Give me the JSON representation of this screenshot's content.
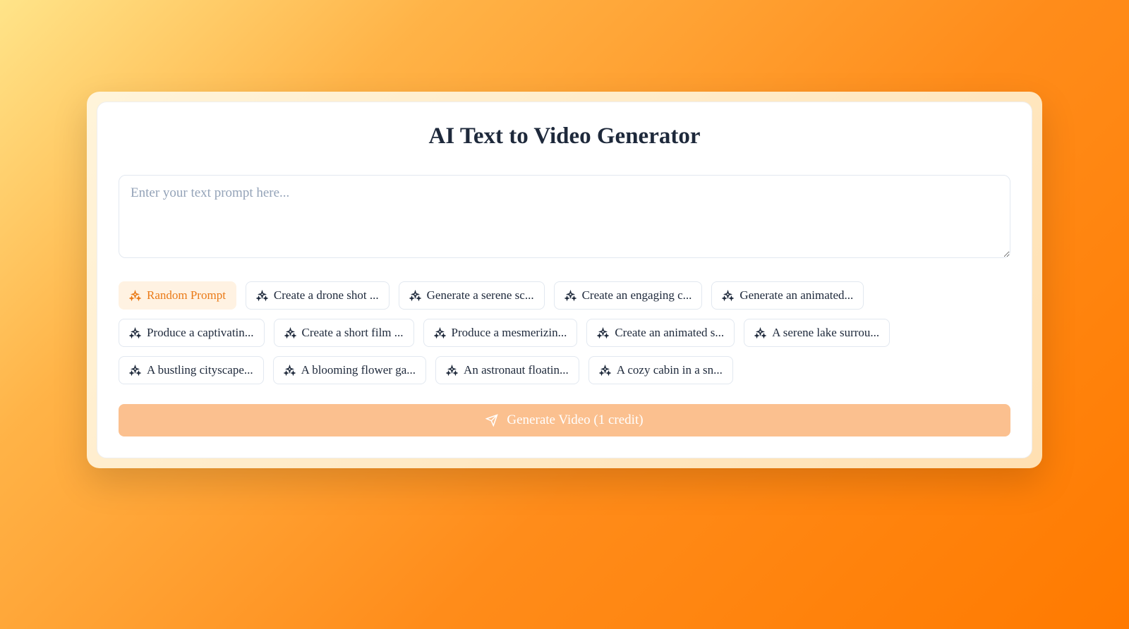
{
  "title": "AI Text to Video Generator",
  "prompt": {
    "placeholder": "Enter your text prompt here...",
    "value": ""
  },
  "chips": {
    "random": "Random Prompt",
    "items": [
      "Create a drone shot ...",
      "Generate a serene sc...",
      "Create an engaging c...",
      "Generate an animated...",
      "Produce a captivatin...",
      "Create a short film ...",
      "Produce a mesmerizin...",
      "Create an animated s...",
      "A serene lake surrou...",
      "A bustling cityscape...",
      "A blooming flower ga...",
      "An astronaut floatin...",
      "A cozy cabin in a sn..."
    ]
  },
  "generate": {
    "label": "Generate Video (1 credit)"
  }
}
